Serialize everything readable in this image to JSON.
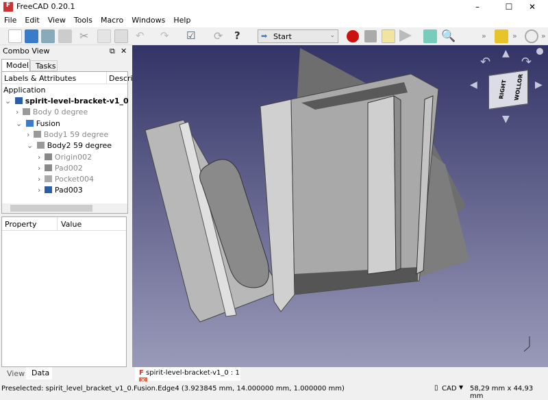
{
  "window": {
    "title": "FreeCAD 0.20.1",
    "minimize": "–",
    "maximize": "☐",
    "close": "✕"
  },
  "menu": [
    "File",
    "Edit",
    "View",
    "Tools",
    "Macro",
    "Windows",
    "Help"
  ],
  "toolbar": {
    "workbench": "Start",
    "overflow": "»"
  },
  "combo": {
    "title": "Combo View",
    "tabs": [
      "Model",
      "Tasks"
    ],
    "col_labels": "Labels & Attributes",
    "col_desc": "Descrip",
    "application": "Application",
    "tree": [
      {
        "label": "spirit-level-bracket-v1_0",
        "depth": 0,
        "expanded": true,
        "bold": true,
        "dim": false,
        "icon": "document-icon"
      },
      {
        "label": "Body 0 degree",
        "depth": 1,
        "expanded": false,
        "dim": true,
        "icon": "body-icon"
      },
      {
        "label": "Fusion",
        "depth": 1,
        "expanded": true,
        "dim": false,
        "icon": "fusion-icon"
      },
      {
        "label": "Body1 59 degree",
        "depth": 2,
        "expanded": false,
        "dim": true,
        "icon": "body-icon"
      },
      {
        "label": "Body2 59 degree",
        "depth": 2,
        "expanded": true,
        "dim": false,
        "icon": "body-icon"
      },
      {
        "label": "Origin002",
        "depth": 3,
        "expanded": false,
        "dim": true,
        "icon": "origin-icon"
      },
      {
        "label": "Pad002",
        "depth": 3,
        "expanded": false,
        "dim": true,
        "icon": "pad-icon"
      },
      {
        "label": "Pocket004",
        "depth": 3,
        "expanded": false,
        "dim": true,
        "icon": "pocket-icon"
      },
      {
        "label": "Pad003",
        "depth": 3,
        "expanded": false,
        "dim": false,
        "icon": "pad-icon"
      }
    ],
    "prop_headers": [
      "Property",
      "Value"
    ],
    "bottom_tabs": [
      "View",
      "Data"
    ]
  },
  "navcube": {
    "face_front": "RIGHT",
    "face_right": "WOLLOR"
  },
  "doc_tab": "spirit-level-bracket-v1_0 : 1",
  "status": {
    "message": "Preselected: spirit_level_bracket_v1_0.Fusion.Edge4 (3.923845 mm, 14.000000 mm, 1.000000 mm)",
    "nav_style": "CAD",
    "dimensions": "58,29 mm x 44,93 mm"
  },
  "colors": {
    "record": "#cc1111",
    "bg_top": "#333466",
    "bg_bottom": "#9a9aba"
  }
}
